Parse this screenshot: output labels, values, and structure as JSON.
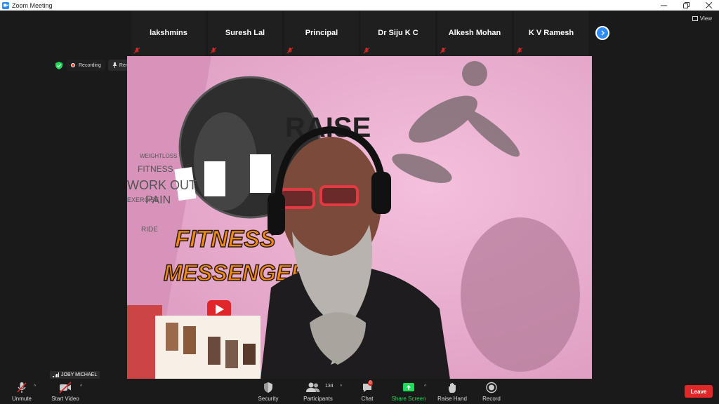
{
  "window": {
    "title": "Zoom Meeting"
  },
  "view_label": "View",
  "participants_strip": [
    {
      "name": "lakshmins"
    },
    {
      "name": "Suresh Lal"
    },
    {
      "name": "Principal"
    },
    {
      "name": "Dr Siju K C"
    },
    {
      "name": "Alkesh Mohan"
    },
    {
      "name": "K V Ramesh"
    }
  ],
  "status": {
    "recording_label": "Recording",
    "spotlight_label": "Remove Spotlight"
  },
  "video": {
    "wall_text_1": "RAISE",
    "wall_text_2": "FITNESS",
    "wall_text_3": "MESSENGER",
    "wall_words": [
      "WEIGHTLOSS",
      "FITNESS",
      "WORK OUT",
      "EXERCISE",
      "PAIN",
      "RIDE"
    ]
  },
  "self_view": {
    "name": "JOBY MICHAEL"
  },
  "toolbar": {
    "unmute": "Unmute",
    "start_video": "Start Video",
    "security": "Security",
    "participants": "Participants",
    "participants_count": "134",
    "chat": "Chat",
    "chat_badge": "8",
    "share_screen": "Share Screen",
    "raise_hand": "Raise Hand",
    "record": "Record",
    "leave": "Leave"
  },
  "colors": {
    "accent_blue": "#2d8cff",
    "share_green": "#23d959",
    "leave_red": "#e02828",
    "wall_pink": "#e8a9c8"
  }
}
